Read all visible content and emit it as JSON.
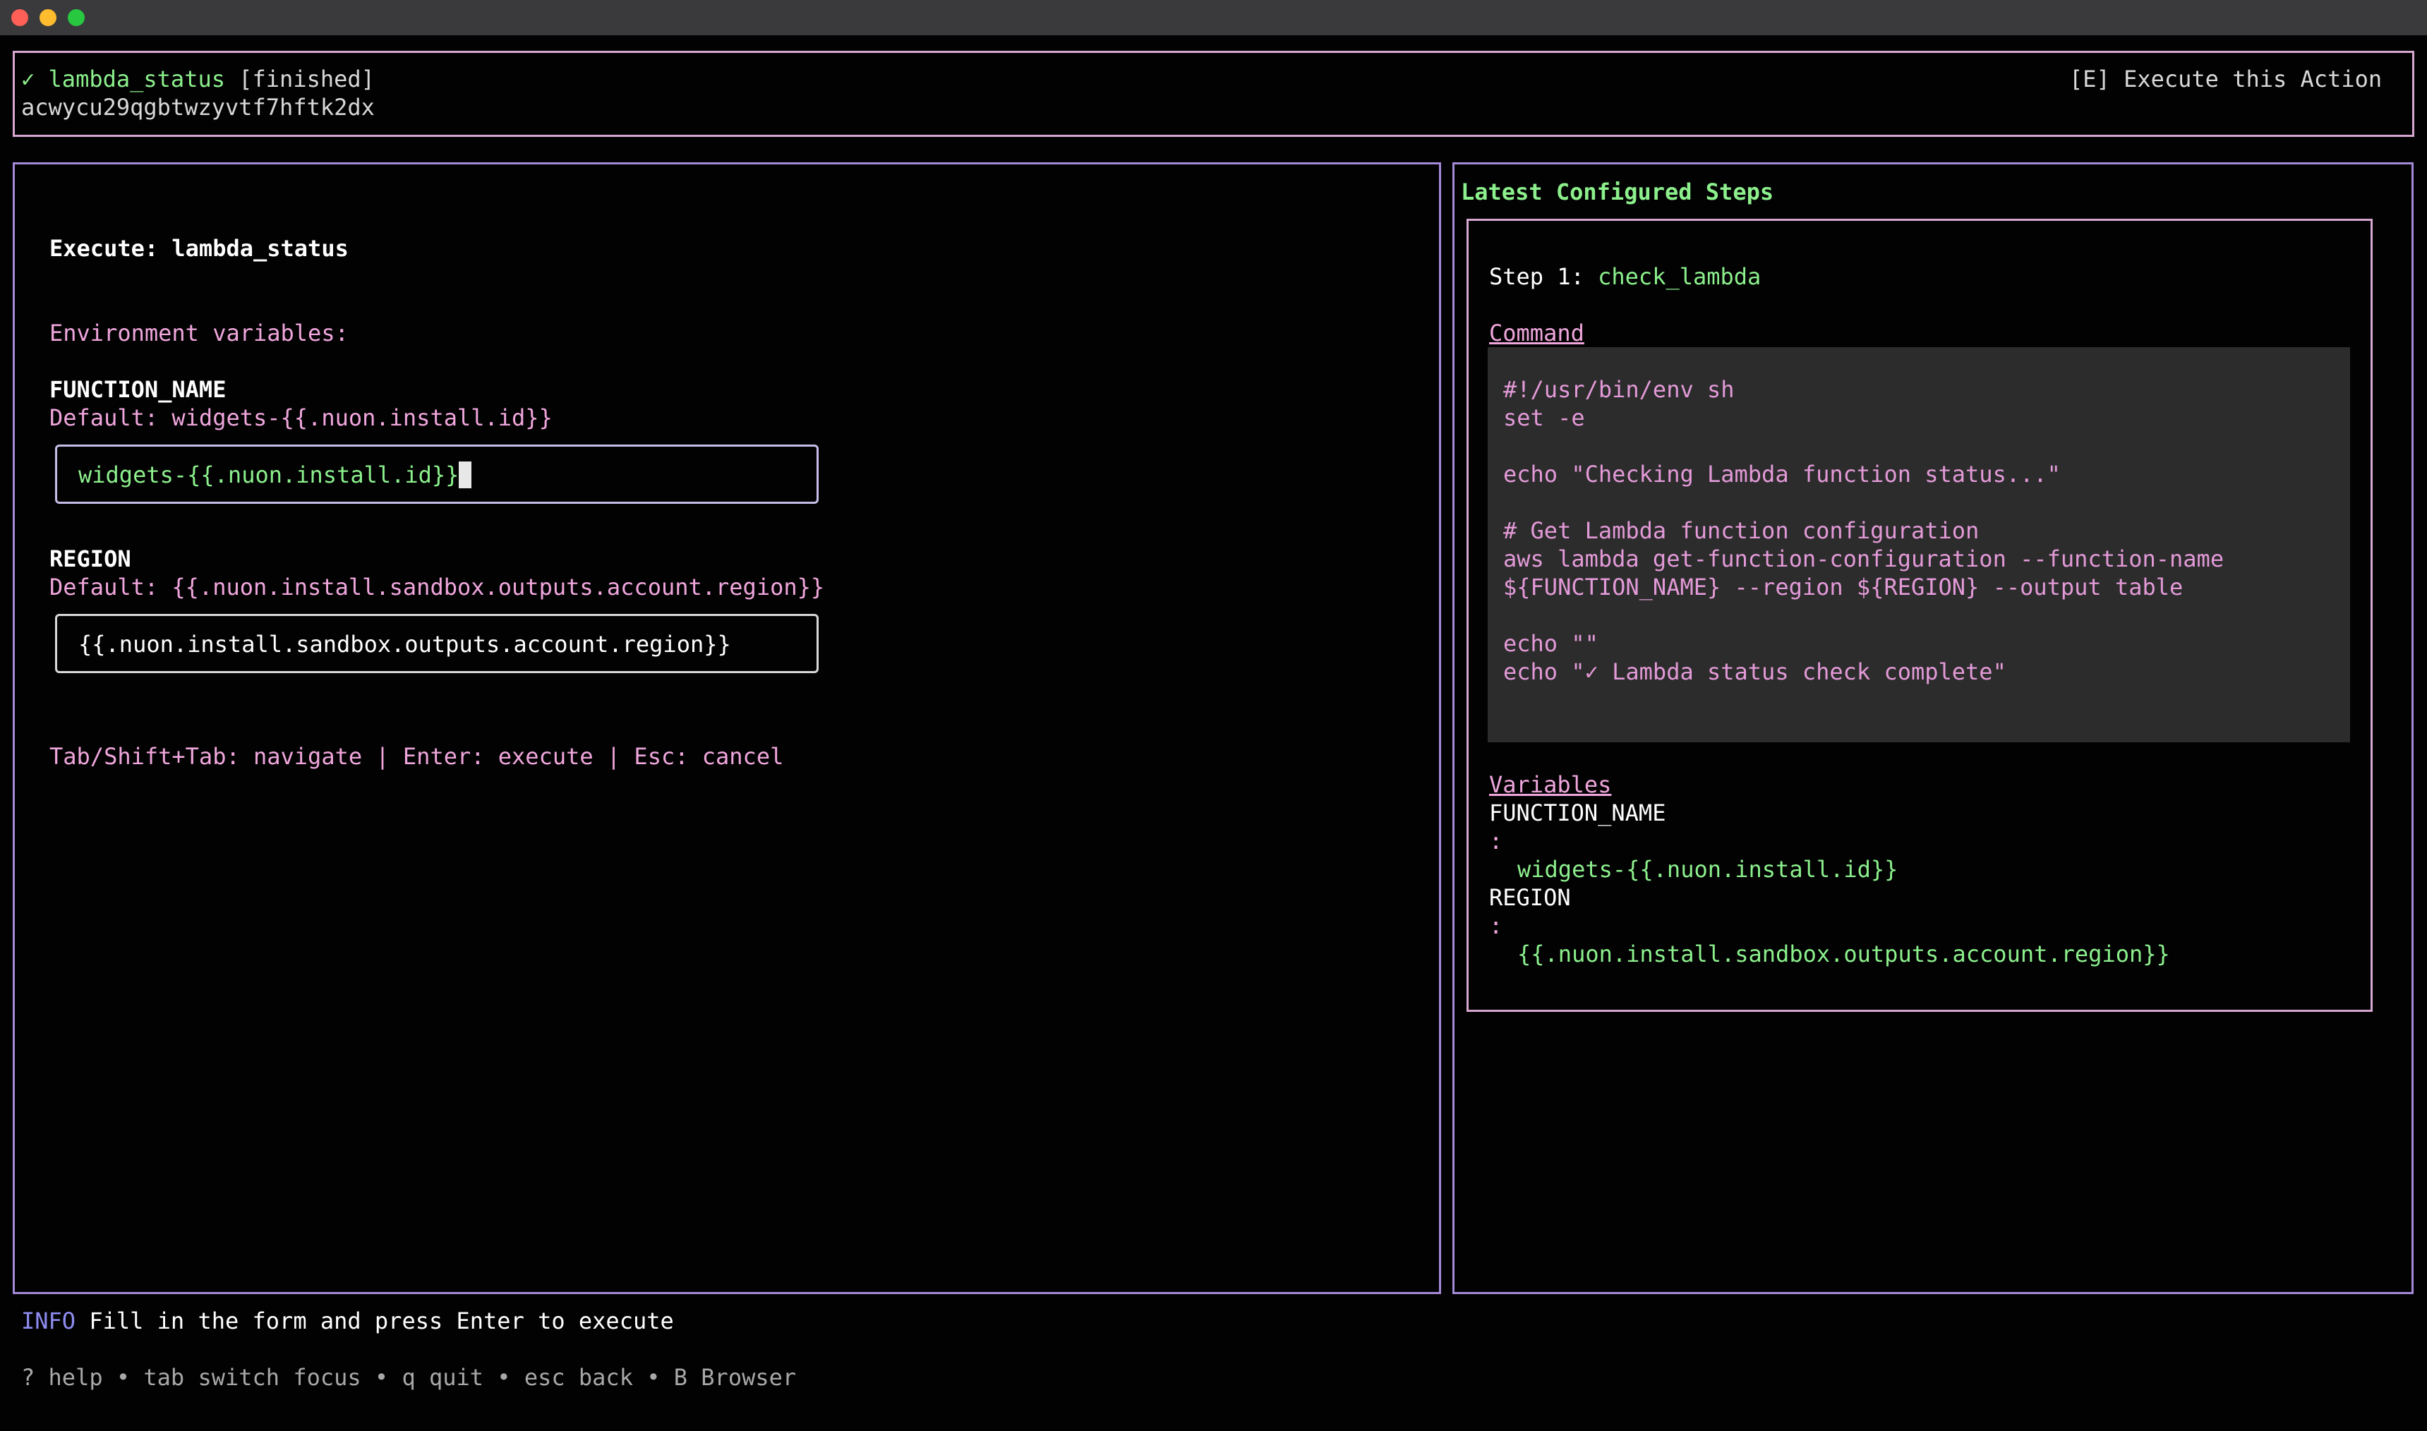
{
  "window": {
    "controls": [
      "close",
      "minimize",
      "zoom"
    ]
  },
  "header": {
    "check": "✓",
    "name": "lambda_status",
    "status": "[finished]",
    "id": "acwycu29qgbtwzyvtf7hftk2dx",
    "execute_action": "[E] Execute this Action"
  },
  "form": {
    "title": "Execute: lambda_status",
    "env_label": "Environment variables:",
    "fields": [
      {
        "name": "FUNCTION_NAME",
        "default": "Default: widgets-{{.nuon.install.id}}",
        "value": "widgets-{{.nuon.install.id}}"
      },
      {
        "name": "REGION",
        "default": "Default: {{.nuon.install.sandbox.outputs.account.region}}",
        "value": "{{.nuon.install.sandbox.outputs.account.region}}"
      }
    ],
    "hint": "Tab/Shift+Tab: navigate | Enter: execute | Esc: cancel"
  },
  "steps": {
    "title": "Latest Configured Steps",
    "step_prefix": "Step 1: ",
    "step_name": "check_lambda",
    "command_label": "Command",
    "code_lines": [
      "#!/usr/bin/env sh",
      "set -e",
      "",
      "echo \"Checking Lambda function status...\"",
      "",
      "# Get Lambda function configuration",
      "aws lambda get-function-configuration --function-name",
      "${FUNCTION_NAME} --region ${REGION} --output table",
      "",
      "echo \"\"",
      "echo \"✓ Lambda status check complete\""
    ],
    "variables_label": "Variables",
    "variables": [
      {
        "name": "FUNCTION_NAME",
        "sep": ":",
        "value": "widgets-{{.nuon.install.id}}"
      },
      {
        "name": "REGION",
        "sep": ":",
        "value": "{{.nuon.install.sandbox.outputs.account.region}}"
      }
    ]
  },
  "status": {
    "level": "INFO",
    "message": "Fill in the form and press Enter to execute"
  },
  "footer": "? help • tab switch focus • q quit • esc back • B Browser",
  "colors": {
    "accent_green": "#8cf08c",
    "accent_pink": "#f0a6dc",
    "border_pink": "#d6a7cf",
    "border_violet": "#a58ad8",
    "info_blue": "#8e8cf0"
  }
}
